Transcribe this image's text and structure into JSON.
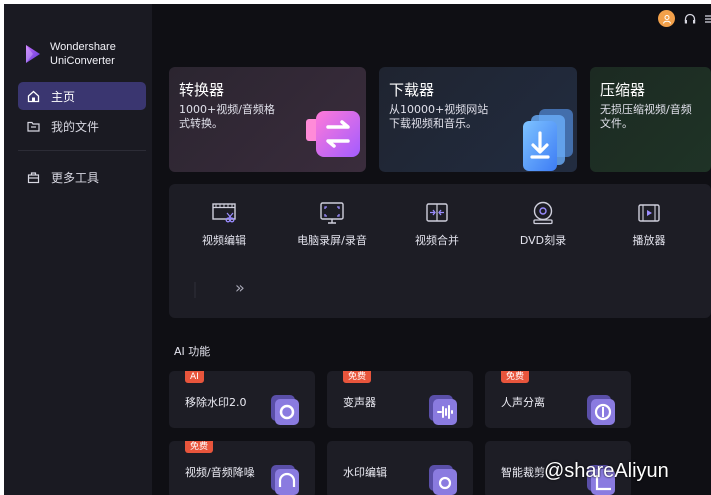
{
  "brand": {
    "line1": "Wondershare",
    "line2": "UniConverter"
  },
  "sidebar": {
    "items": [
      {
        "label": "主页",
        "icon": "home-icon",
        "active": true
      },
      {
        "label": "我的文件",
        "icon": "folder-icon",
        "active": false
      },
      {
        "label": "更多工具",
        "icon": "toolbox-icon",
        "active": false
      }
    ]
  },
  "topbar": {
    "icons": [
      "avatar-icon",
      "headset-icon",
      "menu-icon"
    ]
  },
  "feature_cards": [
    {
      "title": "转换器",
      "desc": "1000+视频/音频格式转换。",
      "icon": "converter-icon",
      "bg": "#2a2430"
    },
    {
      "title": "下载器",
      "desc": "从10000+视频网站下载视频和音乐。",
      "icon": "downloader-icon",
      "bg": "#1f2532"
    },
    {
      "title": "压缩器",
      "desc": "无损压缩视频/音频文件。",
      "icon": "compressor-icon",
      "bg": "#1d2b22"
    }
  ],
  "tools": [
    {
      "label": "视频编辑",
      "icon": "video-edit-icon"
    },
    {
      "label": "电脑录屏/录音",
      "icon": "screen-record-icon"
    },
    {
      "label": "视频合并",
      "icon": "video-merge-icon"
    },
    {
      "label": "DVD刻录",
      "icon": "dvd-burn-icon"
    },
    {
      "label": "播放器",
      "icon": "player-icon"
    }
  ],
  "tools_more": "»",
  "ai_section": {
    "heading": "AI 功能",
    "items": [
      {
        "label": "移除水印2.0",
        "badge": "AI",
        "icon": "watermark-remove-icon"
      },
      {
        "label": "变声器",
        "badge": "免费",
        "icon": "voice-changer-icon"
      },
      {
        "label": "人声分离",
        "badge": "免费",
        "icon": "vocal-separation-icon"
      },
      {
        "label": "视频/音频降噪",
        "badge": "免费",
        "icon": "noise-reduction-icon"
      },
      {
        "label": "水印编辑",
        "badge": "",
        "icon": "watermark-edit-icon"
      },
      {
        "label": "智能裁剪",
        "badge": "",
        "icon": "smart-crop-icon"
      }
    ]
  },
  "watermark": "@shareAliyun",
  "colors": {
    "accent": "#6b5ce7",
    "sidebar_active": "#3a3670",
    "badge": "#e8553c",
    "avatar": "#f2a04a"
  }
}
